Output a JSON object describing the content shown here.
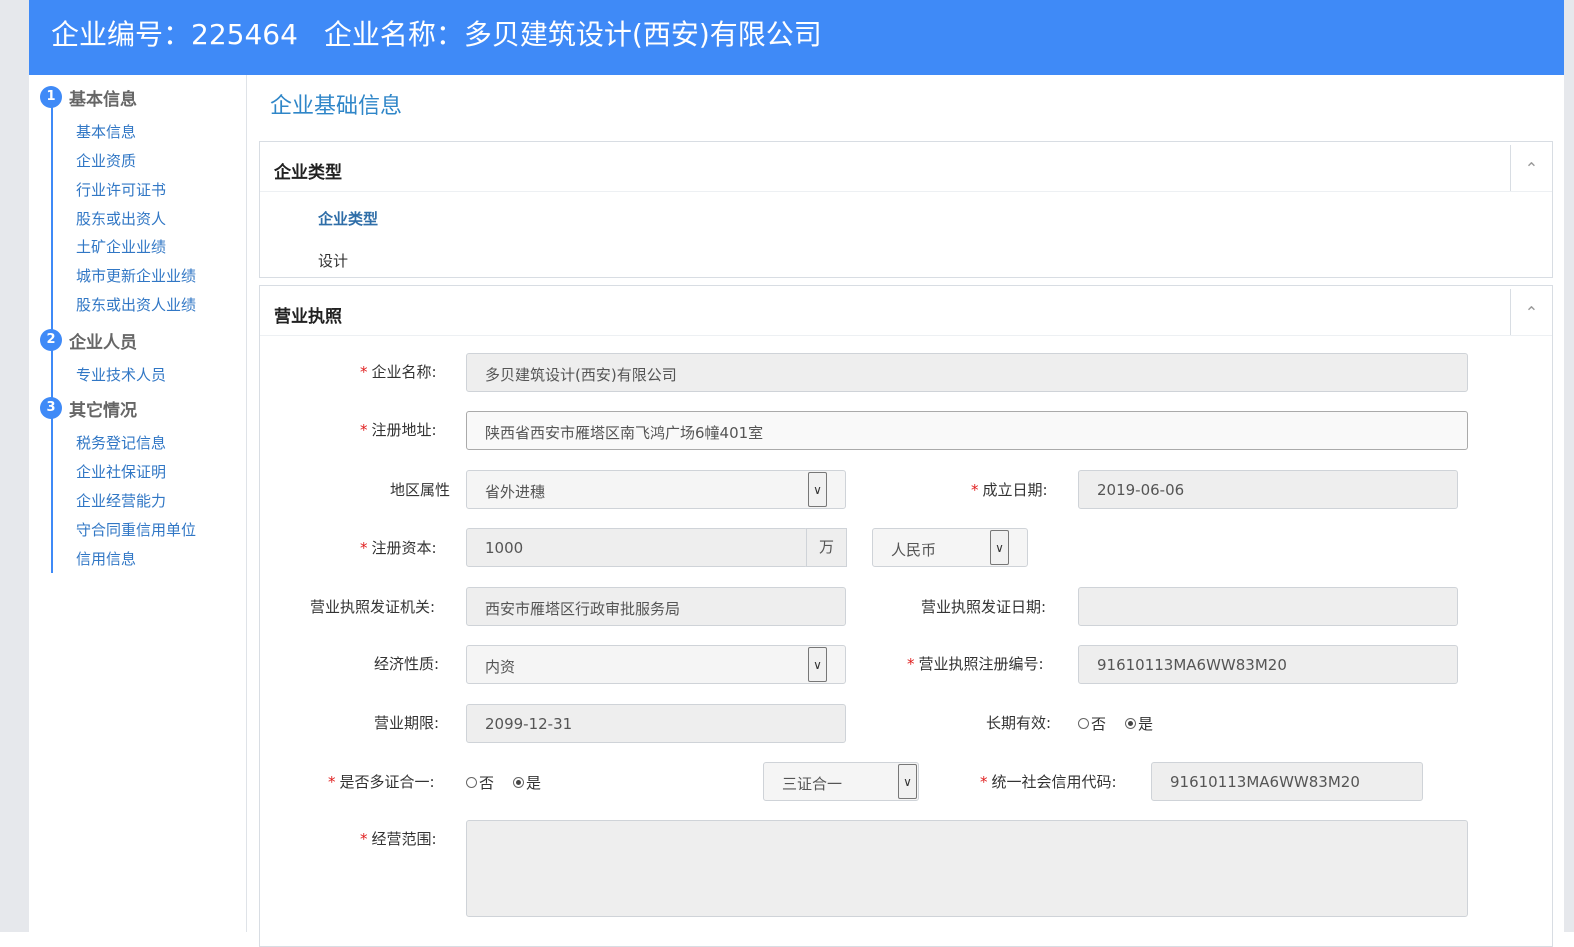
{
  "header": {
    "company_no_label": "企业编号：225464",
    "company_name_label": "企业名称：多贝建筑设计(西安)有限公司"
  },
  "sidebar": {
    "sections": [
      {
        "num": "1",
        "title": "基本信息",
        "items": [
          "基本信息",
          "企业资质",
          "行业许可证书",
          "股东或出资人",
          "土矿企业业绩",
          "城市更新企业业绩",
          "股东或出资人业绩"
        ]
      },
      {
        "num": "2",
        "title": "企业人员",
        "items": [
          "专业技术人员"
        ]
      },
      {
        "num": "3",
        "title": "其它情况",
        "items": [
          "税务登记信息",
          "企业社保证明",
          "企业经营能力",
          "守合同重信用单位",
          "信用信息"
        ]
      }
    ]
  },
  "main": {
    "page_title": "企业基础信息",
    "type_panel": {
      "title": "企业类型",
      "sub_heading": "企业类型",
      "value": "设计"
    },
    "license_panel": {
      "title": "营业执照",
      "required_mark": "*",
      "company_name": {
        "label": "企业名称:",
        "value": "多贝建筑设计(西安)有限公司"
      },
      "reg_address": {
        "label": "注册地址:",
        "value": "陕西省西安市雁塔区南飞鸿广场6幢401室"
      },
      "region": {
        "label": "地区属性",
        "value": "省外进穗"
      },
      "found_date": {
        "label": "成立日期:",
        "value": "2019-06-06"
      },
      "reg_capital": {
        "label": "注册资本:",
        "value": "1000",
        "unit": "万",
        "currency": "人民币"
      },
      "issuing_authority": {
        "label": "营业执照发证机关:",
        "value": "西安市雁塔区行政审批服务局"
      },
      "issue_date": {
        "label": "营业执照发证日期:",
        "value": ""
      },
      "economic_nature": {
        "label": "经济性质:",
        "value": "内资"
      },
      "license_no": {
        "label": "营业执照注册编号:",
        "value": "91610113MA6WW83M20"
      },
      "business_term": {
        "label": "营业期限:",
        "value": "2099-12-31"
      },
      "long_term": {
        "label": "长期有效:",
        "options": [
          "否",
          "是"
        ],
        "selected": "是"
      },
      "multi_cert": {
        "label": "是否多证合一:",
        "options": [
          "否",
          "是"
        ],
        "selected": "是",
        "type_value": "三证合一"
      },
      "credit_code": {
        "label": "统一社会信用代码:",
        "value": "91610113MA6WW83M20"
      },
      "business_scope": {
        "label": "经营范围:",
        "value": ""
      }
    }
  },
  "icons": {
    "collapse": "chevron-up-icon",
    "dropdown": "chevron-down-icon"
  },
  "colors": {
    "header": "#3f8af7",
    "link": "#3177c5",
    "title": "#2f86c8",
    "required": "#e02020"
  }
}
